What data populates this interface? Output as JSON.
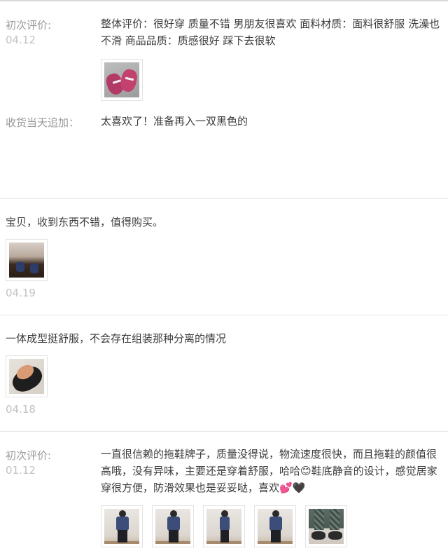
{
  "reviews": [
    {
      "initial_label": "初次评价:",
      "initial_date": "04.12",
      "initial_line1": "整体评价：很好穿 质量不错 男朋友很喜欢 面料材质：面料很舒服 洗澡也",
      "initial_line2": "不滑 商品品质：质感很好 踩下去很软",
      "followup_label": "收货当天追加：",
      "followup_text": "太喜欢了！准备再入一双黑色的"
    },
    {
      "text": "宝贝，收到东西不错，值得购买。",
      "date": "04.19"
    },
    {
      "text": "一体成型挺舒服，不会存在组装那种分离的情况",
      "date": "04.18"
    },
    {
      "initial_label": "初次评价:",
      "initial_date": "01.12",
      "line1": "一直很信赖的拖鞋牌子，质量没得说，物流速度很快，而且拖鞋的颜值很",
      "line2": "高哦，没有异味，主要还是穿着舒服，哈哈😊鞋底静音的设计，感觉居家",
      "line3": "穿很方便，防滑效果也是妥妥哒，喜欢💕🖤"
    }
  ],
  "colors": {
    "text": "#3c3c3c",
    "label": "#9a9a9a",
    "date": "#c2c2c2",
    "divider": "#e5e5e5"
  }
}
